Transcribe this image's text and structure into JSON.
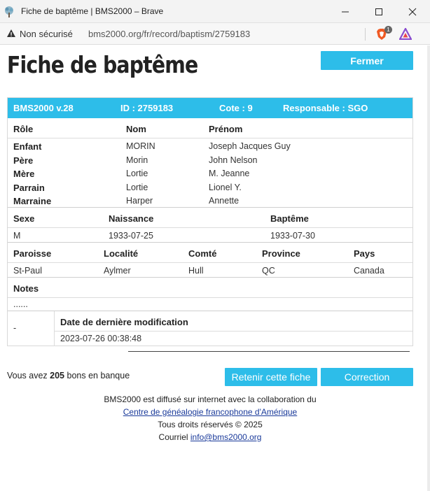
{
  "window": {
    "title": "Fiche de baptême | BMS2000 – Brave",
    "minimize_icon": "minimize-icon",
    "maximize_icon": "maximize-icon",
    "close_icon": "close-icon"
  },
  "addressbar": {
    "security_text": "Non sécurisé",
    "url": "bms2000.org/fr/record/baptism/2759183",
    "shields_badge": "1"
  },
  "page": {
    "title": "Fiche de baptême",
    "close_button": "Fermer"
  },
  "record": {
    "header": {
      "version": "BMS2000 v.28",
      "id": "ID : 2759183",
      "cote": "Cote : 9",
      "responsable": "Responsable : SGO"
    },
    "persons": {
      "headers": [
        "Rôle",
        "Nom",
        "Prénom"
      ],
      "rows": [
        {
          "role": "Enfant",
          "nom": "MORIN",
          "prenom": "Joseph Jacques Guy"
        },
        {
          "role": "Père",
          "nom": "Morin",
          "prenom": "John Nelson"
        },
        {
          "role": "Mère",
          "nom": "Lortie",
          "prenom": "M. Jeanne"
        },
        {
          "role": "Parrain",
          "nom": "Lortie",
          "prenom": "Lionel Y."
        },
        {
          "role": "Marraine",
          "nom": "Harper",
          "prenom": "Annette"
        }
      ]
    },
    "dates": {
      "headers": [
        "Sexe",
        "Naissance",
        "Baptême"
      ],
      "values": [
        "M",
        "1933-07-25",
        "1933-07-30"
      ]
    },
    "place": {
      "headers": [
        "Paroisse",
        "Localité",
        "Comté",
        "Province",
        "Pays"
      ],
      "values": [
        "St-Paul",
        "Aylmer",
        "Hull",
        "QC",
        "Canada"
      ]
    },
    "notes": {
      "header": "Notes",
      "value": "......"
    },
    "modification": {
      "left_value": "-",
      "header": "Date de dernière modification",
      "value": "2023-07-26 00:38:48"
    }
  },
  "bank": {
    "prefix": "Vous avez ",
    "count": "205",
    "suffix": " bons en banque"
  },
  "buttons": {
    "retain": "Retenir cette fiche",
    "correction": "Correction"
  },
  "footer": {
    "line1": "BMS2000 est diffusé sur internet avec la collaboration du",
    "link": "Centre de généalogie francophone d'Amérique",
    "rights": "Tous droits réservés © 2025",
    "email_prefix": "Courriel ",
    "email": "info@bms2000.org"
  }
}
